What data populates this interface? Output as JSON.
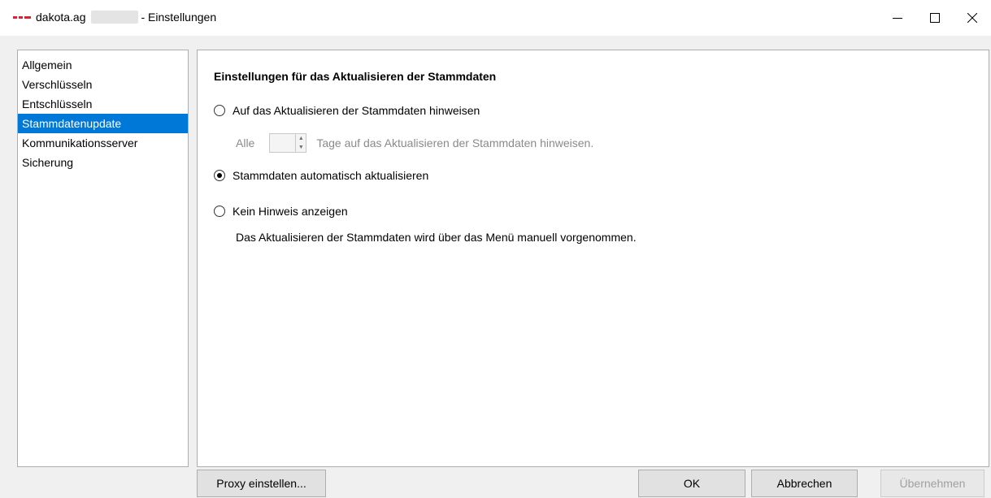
{
  "window": {
    "app_name": "dakota.ag",
    "title_suffix": "- Einstellungen"
  },
  "nav": {
    "items": [
      {
        "label": "Allgemein"
      },
      {
        "label": "Verschlüsseln"
      },
      {
        "label": "Entschlüsseln"
      },
      {
        "label": "Stammdatenupdate",
        "selected": true
      },
      {
        "label": "Kommunikationsserver"
      },
      {
        "label": "Sicherung"
      }
    ]
  },
  "content": {
    "section_title": "Einstellungen für das Aktualisieren der Stammdaten",
    "option_notify": {
      "label": "Auf das Aktualisieren der Stammdaten hinweisen",
      "checked": false
    },
    "interval": {
      "prefix": "Alle",
      "value": "",
      "suffix": "Tage auf das Aktualisieren der Stammdaten hinweisen.",
      "enabled": false
    },
    "option_auto": {
      "label": "Stammdaten automatisch aktualisieren",
      "checked": true
    },
    "option_none": {
      "label": "Kein Hinweis anzeigen",
      "checked": false
    },
    "hint": "Das Aktualisieren der Stammdaten wird über das Menü manuell vorgenommen."
  },
  "buttons": {
    "proxy": "Proxy einstellen...",
    "ok": "OK",
    "cancel": "Abbrechen",
    "apply": "Übernehmen"
  },
  "colors": {
    "selection": "#0078d7",
    "window_bg": "#f0f0f0",
    "brand_red": "#e0203a"
  }
}
